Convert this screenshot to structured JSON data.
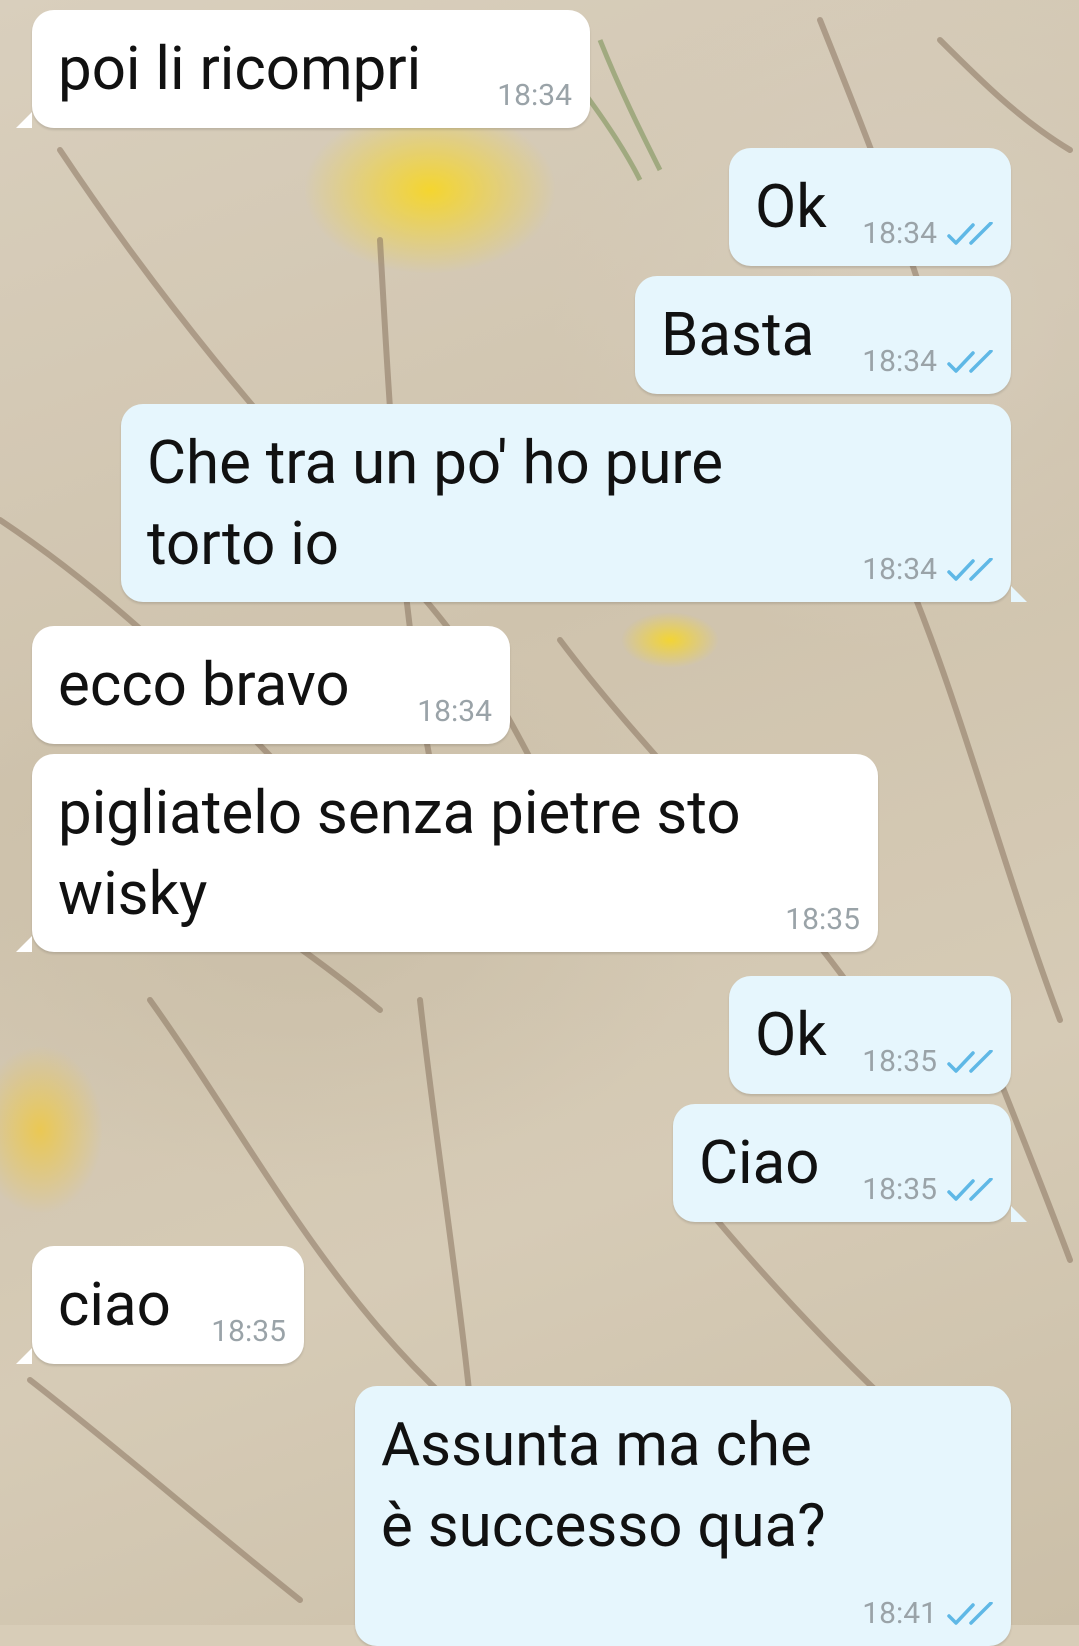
{
  "colors": {
    "incoming_bubble": "#ffffff",
    "outgoing_bubble": "#e6f6fd",
    "read_ticks": "#5fb8e6",
    "timestamp": "#9aa3a8"
  },
  "messages": [
    {
      "direction": "in",
      "text": "poi li ricompri",
      "time": "18:34"
    },
    {
      "direction": "out",
      "text": "Ok",
      "time": "18:34",
      "status": "read-double-check-icon"
    },
    {
      "direction": "out",
      "text": "Basta",
      "time": "18:34",
      "status": "read-double-check-icon"
    },
    {
      "direction": "out",
      "text": "Che tra un po' ho pure torto io",
      "time": "18:34",
      "status": "read-double-check-icon"
    },
    {
      "direction": "in",
      "text": "ecco bravo",
      "time": "18:34"
    },
    {
      "direction": "in",
      "text": "pigliatelo senza pietre sto wisky",
      "time": "18:35"
    },
    {
      "direction": "out",
      "text": "Ok",
      "time": "18:35",
      "status": "read-double-check-icon"
    },
    {
      "direction": "out",
      "text": "Ciao",
      "time": "18:35",
      "status": "read-double-check-icon"
    },
    {
      "direction": "in",
      "text": "ciao",
      "time": "18:35"
    },
    {
      "direction": "out",
      "text": "Assunta ma che è successo qua?",
      "time": "18:41",
      "status": "read-double-check-icon"
    }
  ]
}
